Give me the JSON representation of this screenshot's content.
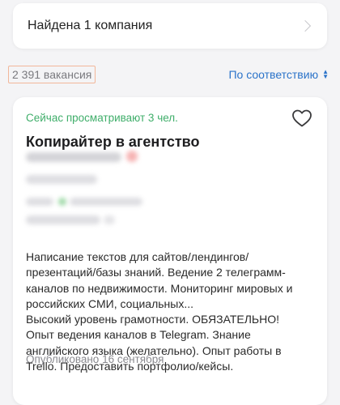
{
  "company_search": {
    "label": "Найдена 1 компания"
  },
  "results": {
    "vacancy_count": "2 391 вакансия",
    "sort_label": "По соответствию"
  },
  "vacancy": {
    "viewing_now": "Сейчас просматривают 3 чел.",
    "title": "Копирайтер в агентство",
    "description": "Написание текстов для сайтов/лендингов/\nпрезентаций/базы знаний. Ведение 2 телеграмм-\nканалов по недвижимости. Мониторинг мировых и\nроссийских СМИ, социальных...\nВысокий уровень грамотности. ОБЯЗАТЕЛЬНО!\nОпыт ведения каналов в Telegram. Знание\nанглийского языка (желательно). Опыт работы в\nTrello. Предоставить портфолио/кейсы.",
    "published": "Опубликовано 16 сентября"
  },
  "colors": {
    "accent_blue": "#2b73c9",
    "status_green": "#3fae6a",
    "highlight_border": "#f2b79a"
  },
  "icons": [
    "chevron-right-icon",
    "sort-arrows-icon",
    "heart-icon"
  ]
}
